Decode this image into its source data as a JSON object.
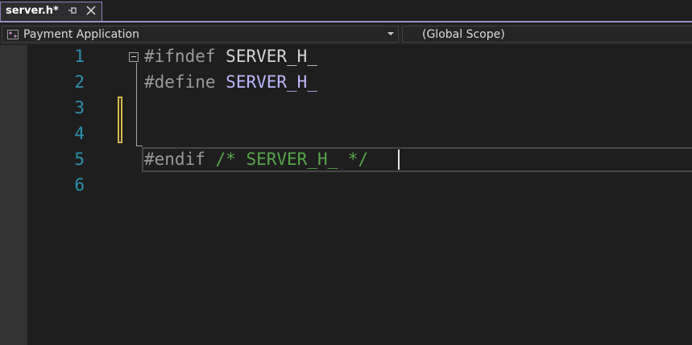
{
  "tab": {
    "title": "server.h*"
  },
  "navbar": {
    "project": "Payment Application",
    "scope": "(Global Scope)"
  },
  "editor": {
    "line_numbers": [
      "1",
      "2",
      "3",
      "4",
      "5",
      "6"
    ],
    "lines": {
      "l1_directive": "#ifndef",
      "l1_symbol": "SERVER_H_",
      "l2_directive": "#define",
      "l2_symbol": "SERVER_H_",
      "l5_directive": "#endif",
      "l5_comment": "/* SERVER_H_ */"
    }
  },
  "colors": {
    "line_number": "#2b91af",
    "preprocessor": "#9b9b9b",
    "macro": "#bdb7ff",
    "comment": "#57a64a",
    "change_marker": "#d9b650",
    "tab_accent": "#9b8ec7"
  }
}
